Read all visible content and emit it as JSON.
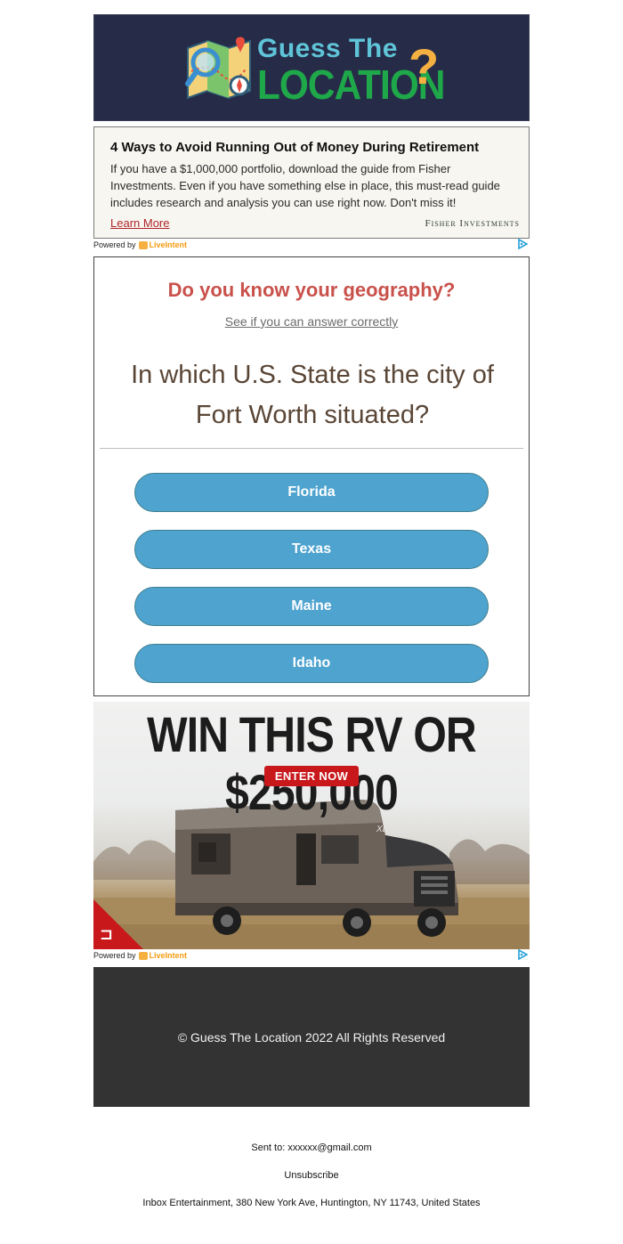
{
  "header": {
    "logo_line1": "Guess The",
    "logo_line2": "LOCATION",
    "logo_mark": "?"
  },
  "ad_top": {
    "title": "4 Ways to Avoid Running Out of Money During Retirement",
    "body": "If you have a $1,000,000 portfolio, download the guide from Fisher Investments. Even if you have something else in place, this must-read guide includes research and analysis you can use right now. Don't miss it!",
    "link": "Learn More",
    "brand": "Fisher Investments"
  },
  "powered_by": {
    "label": "Powered by",
    "provider": "LiveIntent",
    "adchoices_icon": "adchoices-icon"
  },
  "quiz": {
    "heading": "Do you know your geography?",
    "subheading": "See if you can answer correctly",
    "question": "In which U.S. State is the city of Fort Worth situated?",
    "answers": [
      "Florida",
      "Texas",
      "Maine",
      "Idaho"
    ],
    "heading_color": "#c9514b",
    "button_color": "#4ea3cf"
  },
  "rv_ad": {
    "headline": "WIN THIS RV OR $250,000",
    "cta": "ENTER NOW",
    "vehicle_badge": "XL",
    "cta_color": "#c8181c"
  },
  "footer": {
    "copyright": "© Guess The Location 2022 All Rights Reserved"
  },
  "meta": {
    "sent_to": "Sent to: xxxxxx@gmail.com",
    "unsubscribe": "Unsubscribe",
    "address": "Inbox Entertainment, 380 New York Ave, Huntington, NY 11743, United States"
  }
}
